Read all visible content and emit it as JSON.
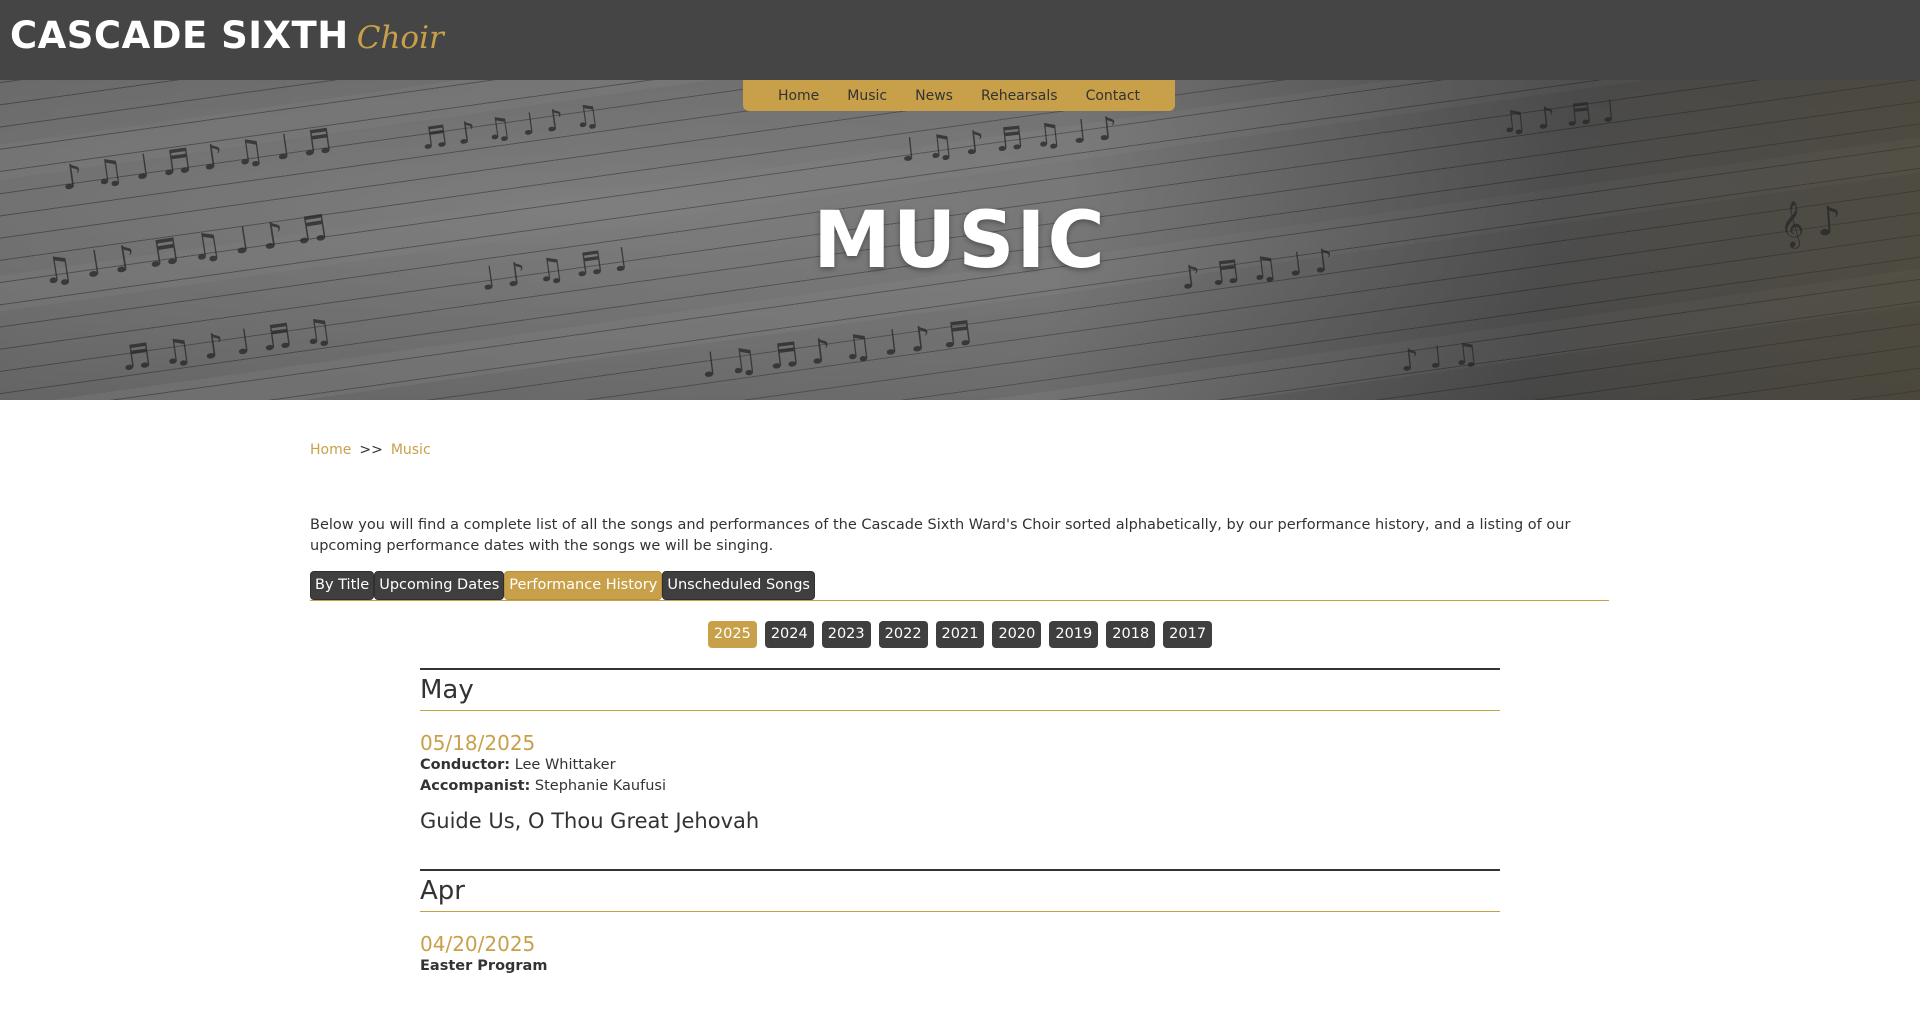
{
  "header": {
    "brand_main": "CASCADE SIXTH",
    "brand_sub": "Choir"
  },
  "nav": {
    "items": [
      {
        "label": "Home"
      },
      {
        "label": "Music"
      },
      {
        "label": "News"
      },
      {
        "label": "Rehearsals"
      },
      {
        "label": "Contact"
      }
    ]
  },
  "hero": {
    "title": "MUSIC"
  },
  "breadcrumb": {
    "home": "Home",
    "separator": ">>",
    "current": "Music"
  },
  "intro": "Below you will find a complete list of all the songs and performances of the Cascade Sixth Ward's Choir sorted alphabetically, by our performance history, and a listing of our upcoming performance dates with the songs we will be singing.",
  "tabs": [
    {
      "label": "By Title",
      "active": false
    },
    {
      "label": "Upcoming Dates",
      "active": false
    },
    {
      "label": "Performance History",
      "active": true
    },
    {
      "label": "Unscheduled Songs",
      "active": false
    }
  ],
  "years": [
    {
      "label": "2025",
      "active": true
    },
    {
      "label": "2024",
      "active": false
    },
    {
      "label": "2023",
      "active": false
    },
    {
      "label": "2022",
      "active": false
    },
    {
      "label": "2021",
      "active": false
    },
    {
      "label": "2020",
      "active": false
    },
    {
      "label": "2019",
      "active": false
    },
    {
      "label": "2018",
      "active": false
    },
    {
      "label": "2017",
      "active": false
    }
  ],
  "history": [
    {
      "month": "May",
      "date": "05/18/2025",
      "conductor_label": "Conductor:",
      "conductor": "Lee Whittaker",
      "accompanist_label": "Accompanist:",
      "accompanist": "Stephanie Kaufusi",
      "song": "Guide Us, O Thou Great Jehovah"
    },
    {
      "month": "Apr",
      "date": "04/20/2025",
      "program": "Easter Program"
    }
  ],
  "colors": {
    "accent": "#c9a04a",
    "topbar": "#454545",
    "button_dark": "#3f3f3f",
    "text": "#333333"
  }
}
